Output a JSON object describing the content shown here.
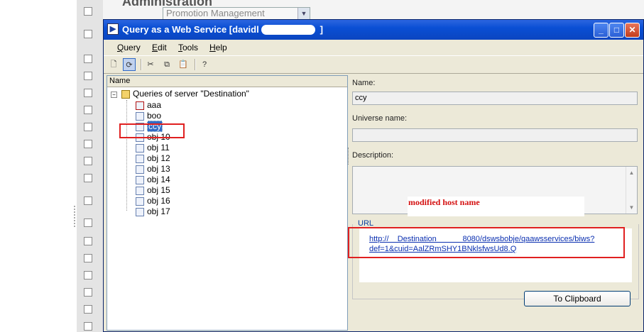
{
  "background": {
    "title": "Administration",
    "select_value": "Promotion Management"
  },
  "window": {
    "title": "Query as a Web Service [davidl -",
    "title_suffix": "]",
    "menu": [
      {
        "label": "Query",
        "u": "Q",
        "rest": "uery"
      },
      {
        "label": "Edit",
        "u": "E",
        "rest": "dit"
      },
      {
        "label": "Tools",
        "u": "T",
        "rest": "ools"
      },
      {
        "label": "Help",
        "u": "H",
        "rest": "elp"
      }
    ],
    "toolbar_icons": [
      "new-doc-icon",
      "refresh-icon",
      "cut-icon",
      "copy-icon",
      "paste-icon",
      "help-icon"
    ]
  },
  "tree": {
    "header": "Name",
    "root_label": "Queries of server  \"Destination\"",
    "items": [
      "aaa",
      "boo",
      "ccy",
      "obj 10",
      "obj 11",
      "obj 12",
      "obj 13",
      "obj 14",
      "obj 15",
      "obj 16",
      "obj 17"
    ],
    "selected": "ccy"
  },
  "details": {
    "name_label": "Name:",
    "name_value": "ccy",
    "universe_label": "Universe name:",
    "universe_value": "",
    "description_label": "Description:",
    "description_value": "",
    "annotation": "modified host name",
    "url_label": "URL",
    "url_line1": "http://    Destination            8080/dswsbobje/qaawsservices/biws?",
    "url_line2": "def=1&cuid=AalZRmSHY1BNklsfwsUd8.Q",
    "clipboard_button": "To Clipboard"
  },
  "colors": {
    "title_bar": "#0a4fd4",
    "highlight_box": "#e02020",
    "selection": "#316ac5",
    "link": "#0a2fb0"
  }
}
